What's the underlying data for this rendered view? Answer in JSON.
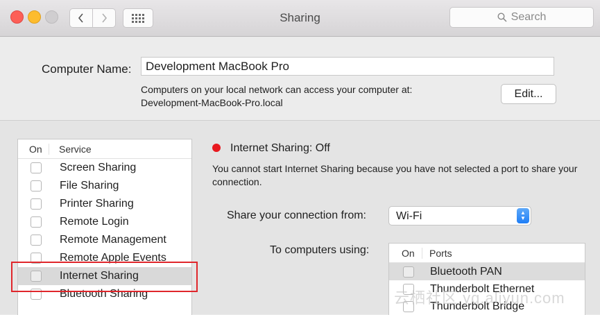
{
  "window": {
    "title": "Sharing"
  },
  "search": {
    "placeholder": "Search"
  },
  "computer_name": {
    "label": "Computer Name:",
    "value": "Development MacBook Pro",
    "description_line1": "Computers on your local network can access your computer at:",
    "description_line2": "Development-MacBook-Pro.local",
    "edit_label": "Edit..."
  },
  "services": {
    "header_on": "On",
    "header_service": "Service",
    "items": [
      {
        "label": "Screen Sharing",
        "checked": false
      },
      {
        "label": "File Sharing",
        "checked": false
      },
      {
        "label": "Printer Sharing",
        "checked": false
      },
      {
        "label": "Remote Login",
        "checked": false
      },
      {
        "label": "Remote Management",
        "checked": false
      },
      {
        "label": "Remote Apple Events",
        "checked": false
      },
      {
        "label": "Internet Sharing",
        "checked": false,
        "selected": true
      },
      {
        "label": "Bluetooth Sharing",
        "checked": false
      }
    ]
  },
  "detail": {
    "status": "Internet Sharing: Off",
    "status_color": "#e8191f",
    "description": "You cannot start Internet Sharing because you have not selected a port to share your connection.",
    "share_from_label": "Share your connection from:",
    "share_from_value": "Wi-Fi",
    "to_computers_label": "To computers using:",
    "ports_header_on": "On",
    "ports_header_ports": "Ports",
    "ports": [
      {
        "label": "Bluetooth PAN",
        "checked": false,
        "selected": true
      },
      {
        "label": "Thunderbolt Ethernet",
        "checked": false
      },
      {
        "label": "Thunderbolt Bridge",
        "checked": false
      }
    ]
  },
  "watermark": "云栖社区 yq.aliyun.com",
  "colors": {
    "highlight": "#e0262b",
    "accent": "#1f7ef6"
  }
}
